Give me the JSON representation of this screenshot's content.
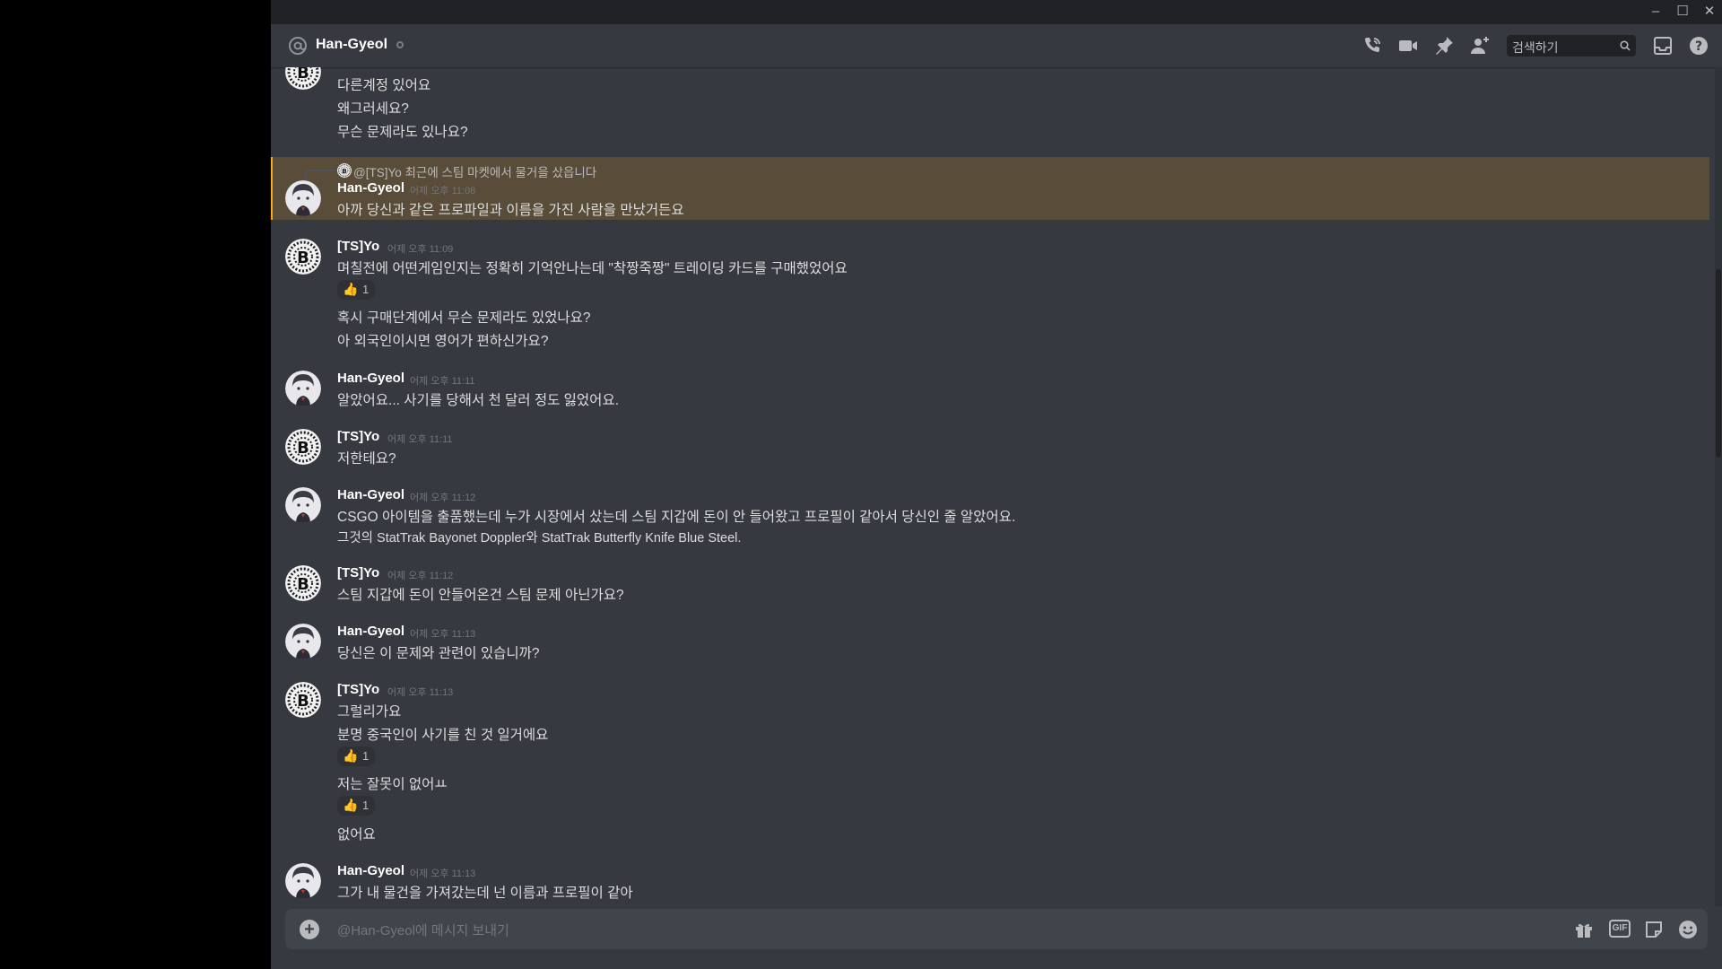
{
  "window": {
    "minimize": "–",
    "maximize": "☐",
    "close": "✕"
  },
  "header": {
    "channel_name": "Han-Gyeol",
    "search_placeholder": "검색하기"
  },
  "messages": [
    {
      "lines": [
        "다른계정 있어요",
        "왜그러세요?",
        "무슨 문제라도 있나요?"
      ]
    },
    {
      "reply_to": "@[TS]Yo 최근에 스팀 마켓에서 물거을 샀읍니다",
      "author": "Han-Gyeol",
      "time": "어제 오후 11:08",
      "lines": [
        "아까 당신과 같은 프로파일과 이름을 가진 사람을 만났거든요"
      ]
    },
    {
      "author": "[TS]Yo",
      "time": "어제 오후 11:09",
      "lines": [
        "며칠전에 어떤게임인지는 정확히 기억안나는데 \"착짱죽짱\" 트레이딩 카드를 구매했었어요",
        "혹시 구매단계에서 무슨 문제라도 있었나요?",
        "아 외국인이시면 영어가 편하신가요?"
      ],
      "reaction": {
        "emoji": "👍",
        "count": "1"
      }
    },
    {
      "author": "Han-Gyeol",
      "time": "어제 오후 11:11",
      "lines": [
        "알았어요... 사기를 당해서 천 달러 정도 잃었어요."
      ]
    },
    {
      "author": "[TS]Yo",
      "time": "어제 오후 11:11",
      "lines": [
        "저한테요?"
      ]
    },
    {
      "author": "Han-Gyeol",
      "time": "어제 오후 11:12",
      "lines": [
        "CSGO 아이템을 출품했는데 누가 시장에서 샀는데 스팀 지갑에 돈이 안 들어왔고 프로필이 같아서 당신인 줄 알았어요.",
        "그것의 StatTrak Bayonet Doppler와 StatTrak Butterfly Knife Blue Steel."
      ]
    },
    {
      "author": "[TS]Yo",
      "time": "어제 오후 11:12",
      "lines": [
        "스팀 지갑에 돈이 안들어온건 스팀 문제 아닌가요?"
      ]
    },
    {
      "author": "Han-Gyeol",
      "time": "어제 오후 11:13",
      "lines": [
        "당신은 이 문제와 관련이 있습니까?"
      ]
    },
    {
      "author": "[TS]Yo",
      "time": "어제 오후 11:13",
      "lines": [
        "그럴리가요",
        "분명 중국인이 사기를 친 것 일거에요",
        "저는 잘못이 없어ㅛ",
        "없어요"
      ],
      "reactions": [
        {
          "emoji": "👍",
          "count": "1"
        },
        {
          "emoji": "👍",
          "count": "1"
        }
      ]
    },
    {
      "author": "Han-Gyeol",
      "time": "어제 오후 11:13",
      "lines": [
        "그가 내 물건을 가져갔는데 넌 이름과 프로필이 같아"
      ]
    }
  ],
  "composer": {
    "placeholder": "@Han-Gyeol에 메시지 보내기",
    "plus": "+",
    "gif_label": "GIF"
  }
}
